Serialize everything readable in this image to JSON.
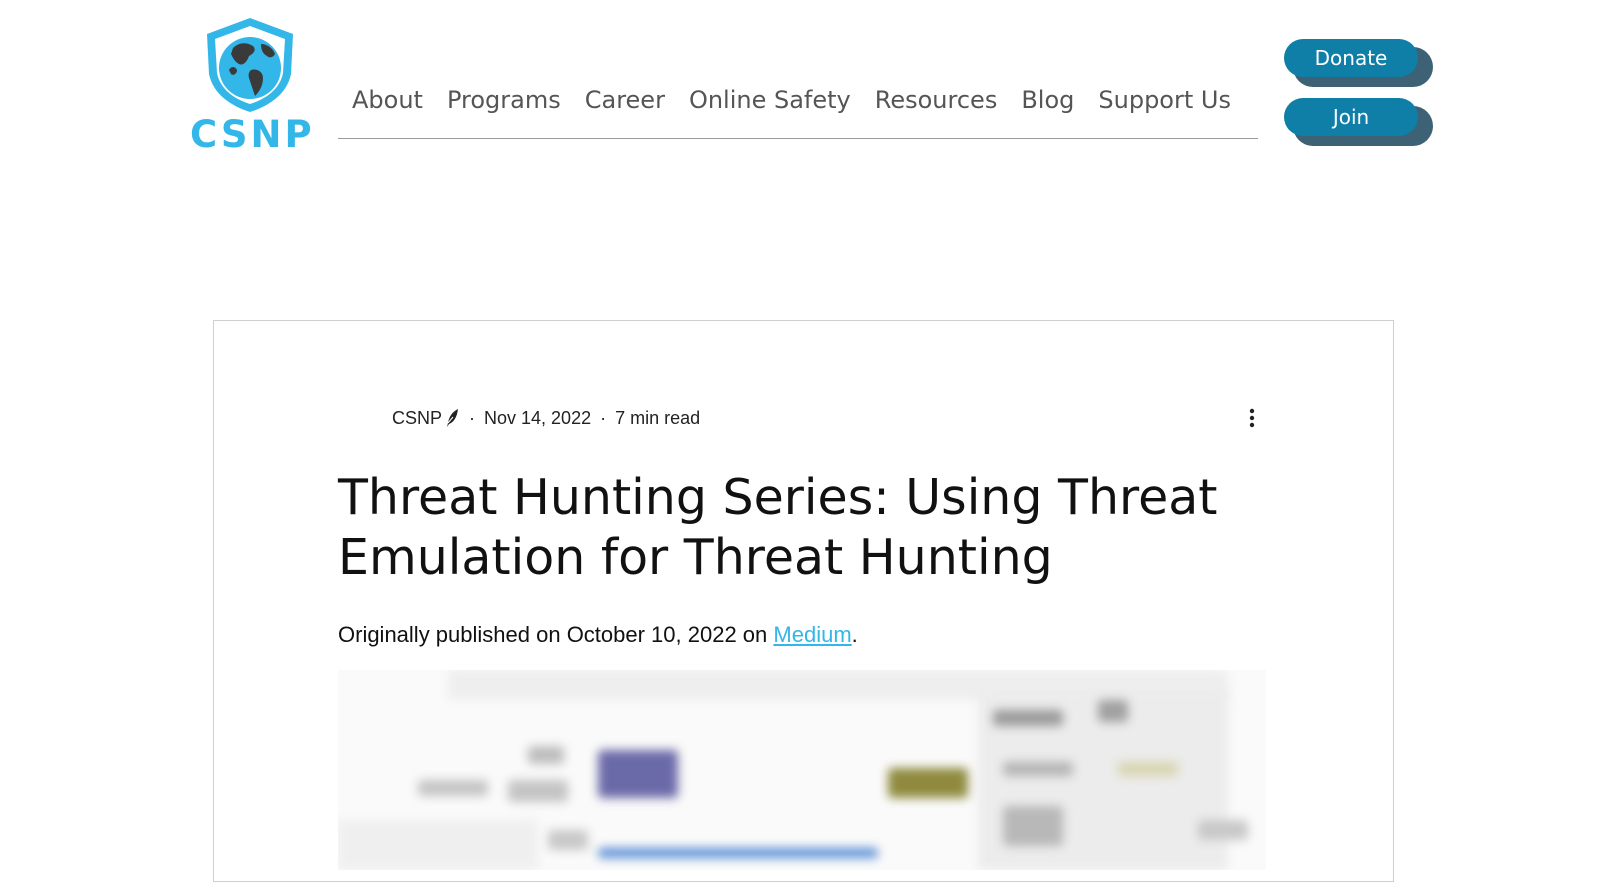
{
  "header": {
    "logo_text": "CSNP",
    "nav": [
      {
        "label": "About"
      },
      {
        "label": "Programs"
      },
      {
        "label": "Career"
      },
      {
        "label": "Online Safety"
      },
      {
        "label": "Resources"
      },
      {
        "label": "Blog"
      },
      {
        "label": "Support Us"
      }
    ],
    "donate_label": "Donate",
    "join_label": "Join"
  },
  "post": {
    "author": "CSNP",
    "date": "Nov 14, 2022",
    "read_time": "7 min read",
    "title": "Threat Hunting Series: Using Threat Emulation for Threat Hunting",
    "intro_prefix": "Originally published on October 10, 2022 on ",
    "intro_link": "Medium",
    "intro_suffix": "."
  },
  "colors": {
    "brand_blue": "#33b6e8",
    "button_bg": "#0f7fa8",
    "button_shadow": "#3e6275"
  }
}
